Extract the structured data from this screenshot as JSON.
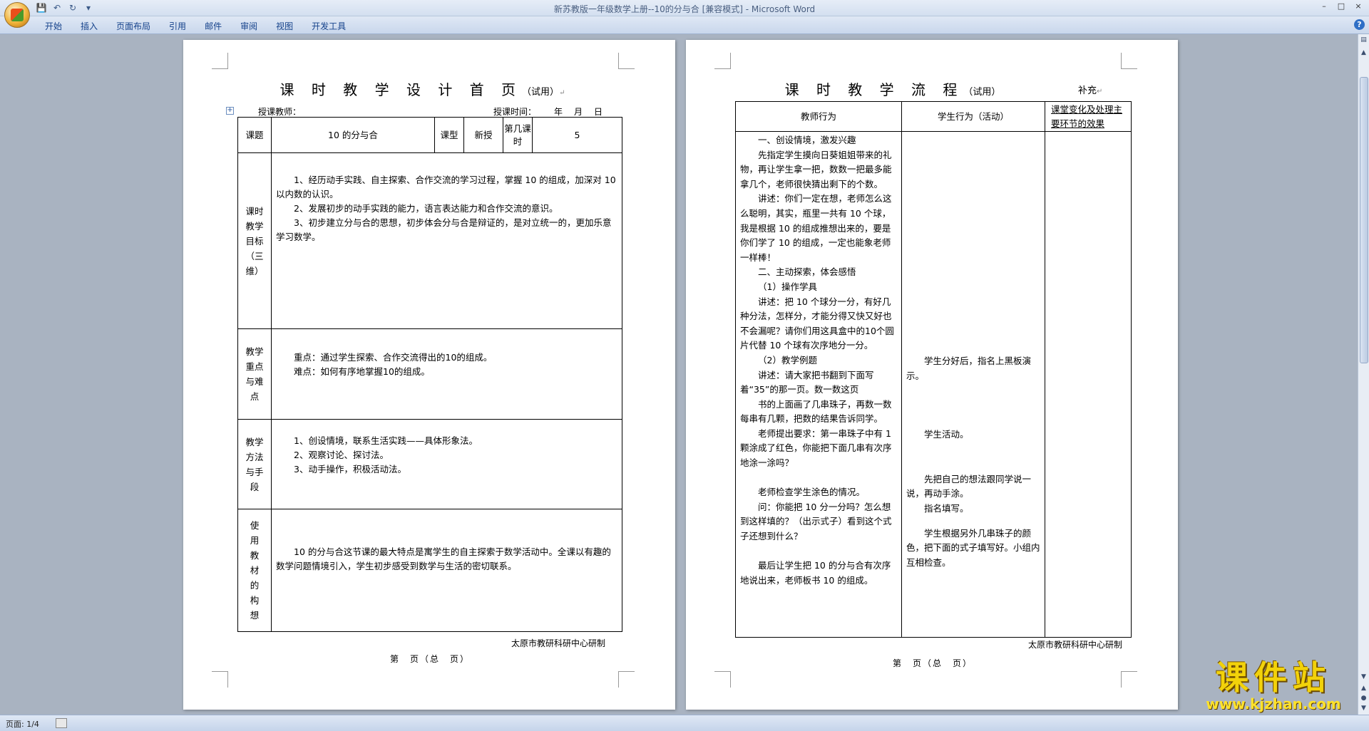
{
  "window": {
    "title": "新苏教版一年级数学上册--10的分与合 [兼容模式] - Microsoft Word",
    "controls": {
      "minimize": "–",
      "maximize": "□",
      "close": "×"
    }
  },
  "qat": {
    "save_icon": "save-icon",
    "undo_icon": "undo-icon",
    "redo_icon": "redo-icon",
    "customize": "▾"
  },
  "ribbon": {
    "tabs": [
      "开始",
      "插入",
      "页面布局",
      "引用",
      "邮件",
      "审阅",
      "视图",
      "开发工具"
    ],
    "help": "?"
  },
  "page1": {
    "title": "课 时 教 学 设 计 首 页",
    "title_suffix": "（试用）",
    "teacher_label": "授课教师：",
    "time_label": "授课时间：",
    "time_value": "年　月　日",
    "row1": {
      "topic_label": "课题",
      "topic_value": "10 的分与合",
      "type_label": "课型",
      "type_value": "新授",
      "period_label": "第几课时",
      "period_value": "5"
    },
    "goals_label": "课时教学目标（三维）",
    "goals": [
      "1、经历动手实践、自主探索、合作交流的学习过程，掌握 10 的组成，加深对 10 以内数的认识。",
      "2、发展初步的动手实践的能力，语言表达能力和合作交流的意识。",
      "3、初步建立分与合的思想，初步体会分与合是辩证的，是对立统一的，更加乐意学习数学。"
    ],
    "focus_label": "教学重点与难点",
    "focus": [
      "重点：通过学生探索、合作交流得出的10的组成。",
      "难点：如何有序地掌握10的组成。"
    ],
    "method_label": "教学方法与手段",
    "methods": [
      "1、创设情境，联系生活实践——具体形象法。",
      "2、观察讨论、探讨法。",
      "3、动手操作，积极活动法。"
    ],
    "idea_label": "使用教材的构想",
    "idea": "10 的分与合这节课的最大特点是寓学生的自主探索于数学活动中。全课以有趣的数学问题情境引入，学生初步感受到数学与生活的密切联系。",
    "footer_org": "太原市教研科研中心研制",
    "footer_page": "第　页（总　页）"
  },
  "page2": {
    "title": "课 时 教 学 流 程",
    "title_suffix": "（试用）",
    "supplement": "补充",
    "headers": [
      "教师行为",
      "学生行为（活动）",
      "课堂变化及处理主要环节的效果"
    ],
    "teacher_lines": [
      "一、创设情境，激发兴趣",
      "先指定学生摸向日葵姐姐带来的礼物，再让学生拿一把，数数一把最多能拿几个，老师很快猜出剩下的个数。",
      "讲述：你们一定在想，老师怎么这么聪明，其实，瓶里一共有 10 个球，我是根据 10 的组成推想出来的，要是你们学了 10 的组成，一定也能象老师一样棒！",
      "二、主动探索，体会感悟",
      "（1）操作学具",
      "讲述：把 10 个球分一分，有好几种分法，怎样分，才能分得又快又好也不会漏呢？请你们用这具盒中的10个圆片代替 10 个球有次序地分一分。",
      "（2）教学例题",
      "讲述：请大家把书翻到下面写着“35”的那一页。数一数这页",
      "书的上面画了几串珠子，再数一数每串有几颗，把数的结果告诉同学。",
      "老师提出要求：第一串珠子中有 1 颗涂成了红色，你能把下面几串有次序地涂一涂吗？",
      "老师检查学生涂色的情况。",
      "问：你能把 10 分一分吗？怎么想到这样填的？（出示式子）看到这个式子还想到什么？",
      "最后让学生把 10 的分与合有次序地说出来，老师板书 10 的组成。"
    ],
    "student_lines": [
      "学生分好后，指名上黑板演示。",
      "学生活动。",
      "先把自己的想法跟同学说一说，再动手涂。",
      "指名填写。",
      "学生根据另外几串珠子的颜色，把下面的式子填写好。小组内互相检查。"
    ],
    "footer_org": "太原市教研科研中心研制",
    "footer_page": "第　页（总　页）"
  },
  "status": {
    "page": "页面: 1/4"
  },
  "watermark": {
    "text": "课件站",
    "url": "www.kjzhan.com"
  }
}
